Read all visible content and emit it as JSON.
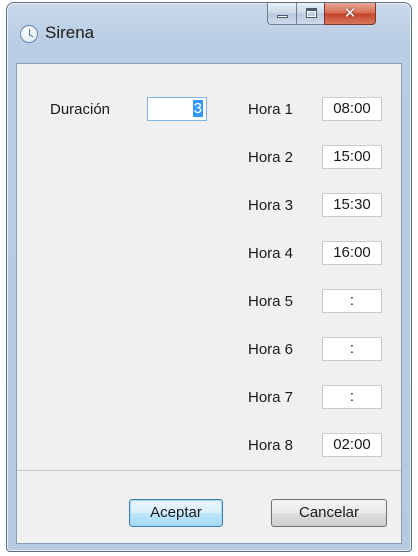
{
  "window": {
    "title": "Sirena"
  },
  "form": {
    "duracion": {
      "label": "Duración",
      "value": "3"
    },
    "horas": [
      {
        "label": "Hora 1",
        "value": "08:00"
      },
      {
        "label": "Hora 2",
        "value": "15:00"
      },
      {
        "label": "Hora 3",
        "value": "15:30"
      },
      {
        "label": "Hora 4",
        "value": "16:00"
      },
      {
        "label": "Hora 5",
        "value": ":"
      },
      {
        "label": "Hora 6",
        "value": ":"
      },
      {
        "label": "Hora 7",
        "value": ":"
      },
      {
        "label": "Hora 8",
        "value": "02:00"
      }
    ]
  },
  "buttons": {
    "accept": "Aceptar",
    "cancel": "Cancelar"
  },
  "icons": {
    "app": "clock-icon",
    "minimize": "minimize-icon",
    "maximize": "maximize-icon",
    "close": "close-icon"
  }
}
